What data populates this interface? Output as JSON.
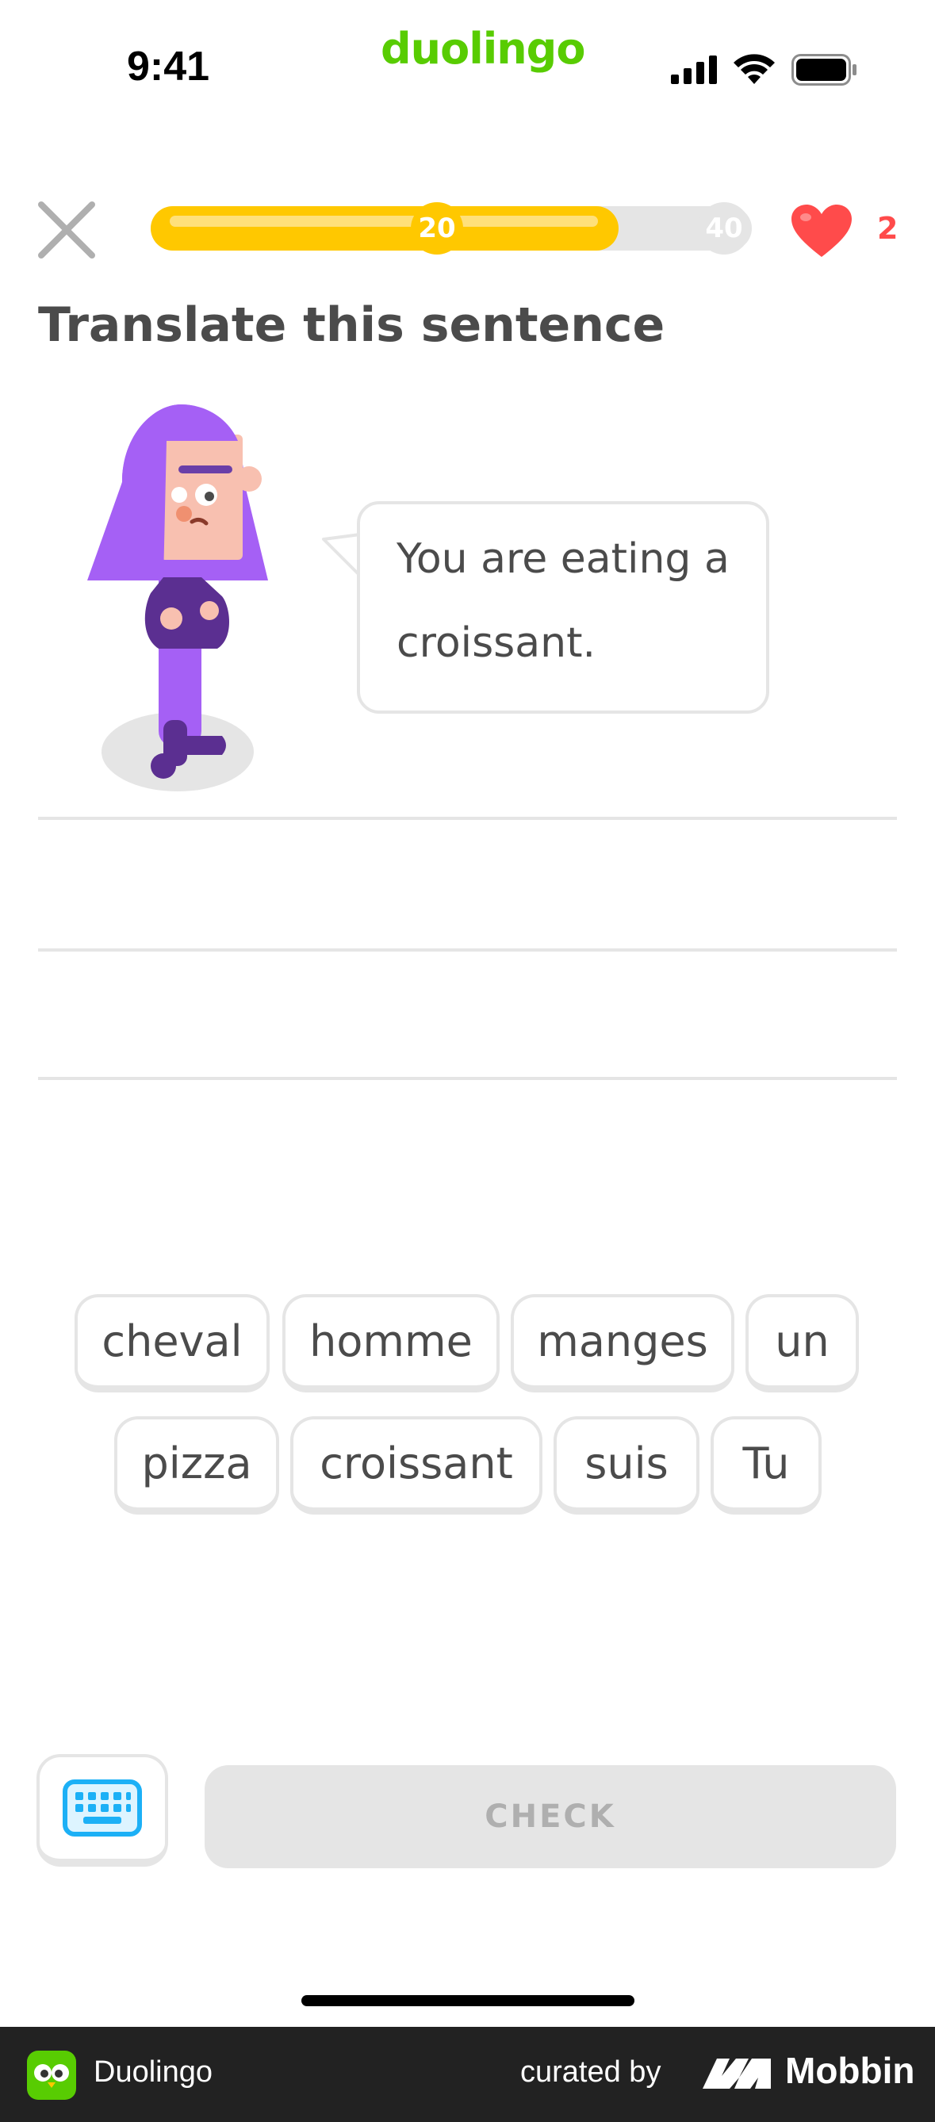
{
  "status_bar": {
    "time": "9:41",
    "brand": "duolingo"
  },
  "lesson": {
    "progress_value": 20,
    "progress_goal": 40,
    "progress_fraction": 0.5,
    "hearts": "2"
  },
  "prompt": {
    "title": "Translate this sentence",
    "sentence_line1": "You are eating a",
    "sentence_line2": "croissant."
  },
  "word_bank": [
    {
      "text": "cheval"
    },
    {
      "text": "homme"
    },
    {
      "text": "manges"
    },
    {
      "text": "un"
    },
    {
      "text": "pizza"
    },
    {
      "text": "croissant"
    },
    {
      "text": "suis"
    },
    {
      "text": "Tu"
    }
  ],
  "actions": {
    "check_label": "CHECK",
    "keyboard_icon": "keyboard-icon"
  },
  "footer": {
    "app_name": "Duolingo",
    "curated_by": "curated by",
    "mobbin": "Mobbin"
  },
  "colors": {
    "brand_green": "#58cc02",
    "progress_yellow": "#ffc800",
    "heart_red": "#ff4b4b",
    "border_gray": "#e5e5e5",
    "text_gray": "#4b4b4b",
    "keyboard_blue": "#1cb0f6",
    "character_purple": "#a560f5"
  }
}
